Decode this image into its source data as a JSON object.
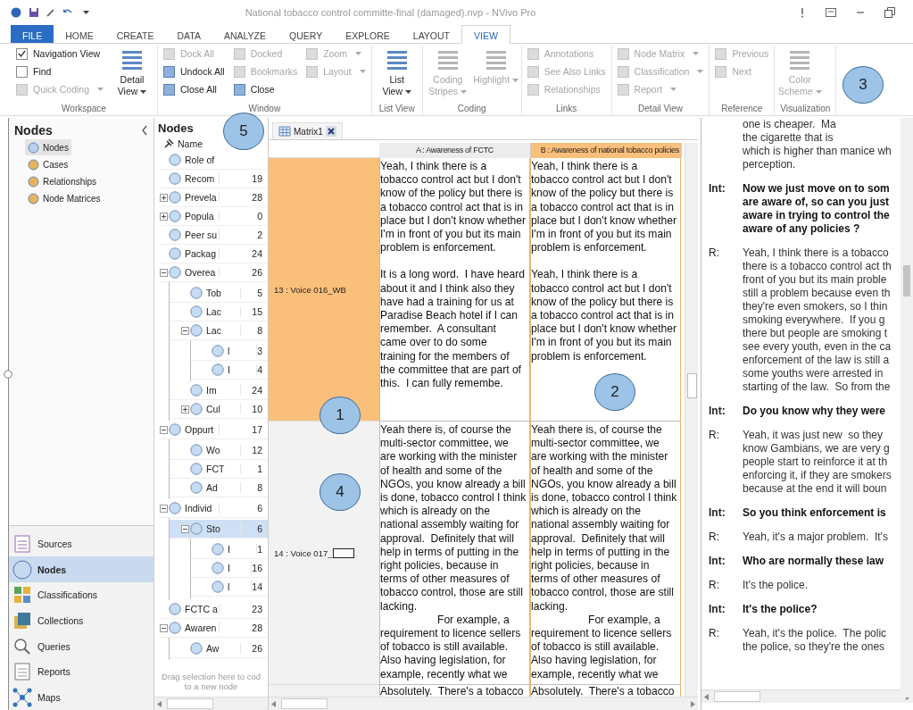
{
  "window": {
    "title": "National tobacco control committe-final (damaged).nvp - NVivo Pro"
  },
  "ribbon": {
    "tabs": [
      {
        "label": "FILE",
        "selected": false,
        "kind": "file"
      },
      {
        "label": "HOME",
        "selected": false
      },
      {
        "label": "CREATE",
        "selected": false
      },
      {
        "label": "DATA",
        "selected": false
      },
      {
        "label": "ANALYZE",
        "selected": false
      },
      {
        "label": "QUERY",
        "selected": false
      },
      {
        "label": "EXPLORE",
        "selected": false
      },
      {
        "label": "LAYOUT",
        "selected": false
      },
      {
        "label": "VIEW",
        "selected": true
      }
    ],
    "groups": [
      {
        "label": "Workspace",
        "columns": [
          [
            {
              "kind": "checkbox",
              "label": "Navigation View",
              "checked": true,
              "disabled": false
            },
            {
              "kind": "checkbox",
              "label": "Find",
              "checked": false,
              "disabled": false
            },
            {
              "kind": "small",
              "label": "Quick Coding",
              "disabled": true,
              "dropdown": true
            }
          ],
          [
            {
              "kind": "large",
              "label": "Detail\nView",
              "disabled": false,
              "dropdown": true
            }
          ]
        ]
      },
      {
        "label": "Window",
        "columns": [
          [
            {
              "kind": "small",
              "label": "Dock All",
              "disabled": true
            },
            {
              "kind": "small",
              "label": "Undock All",
              "disabled": false
            },
            {
              "kind": "small",
              "label": "Close All",
              "disabled": false
            }
          ],
          [
            {
              "kind": "small",
              "label": "Docked",
              "disabled": true
            },
            {
              "kind": "small",
              "label": "Bookmarks",
              "disabled": true
            },
            {
              "kind": "small",
              "label": "Close",
              "disabled": false
            }
          ],
          [
            {
              "kind": "small",
              "label": "Zoom",
              "disabled": true,
              "dropdown": true
            },
            {
              "kind": "small",
              "label": "Layout",
              "disabled": true,
              "dropdown": true
            }
          ]
        ]
      },
      {
        "label": "List View",
        "columns": [
          [
            {
              "kind": "large",
              "label": "List\nView",
              "disabled": false,
              "dropdown": true
            }
          ]
        ]
      },
      {
        "label": "Coding",
        "columns": [
          [
            {
              "kind": "large",
              "label": "Coding\nStripes",
              "disabled": true,
              "dropdown": true
            }
          ],
          [
            {
              "kind": "large",
              "label": "Highlight",
              "disabled": true,
              "dropdown": true
            }
          ]
        ]
      },
      {
        "label": "Links",
        "columns": [
          [
            {
              "kind": "small",
              "label": "Annotations",
              "disabled": true
            },
            {
              "kind": "small",
              "label": "See Also Links",
              "disabled": true
            },
            {
              "kind": "small",
              "label": "Relationships",
              "disabled": true
            }
          ]
        ]
      },
      {
        "label": "Detail View",
        "columns": [
          [
            {
              "kind": "small",
              "label": "Node Matrix",
              "disabled": true,
              "dropdown": true
            },
            {
              "kind": "small",
              "label": "Classification",
              "disabled": true,
              "dropdown": true
            },
            {
              "kind": "small",
              "label": "Report",
              "disabled": true,
              "dropdown": true
            }
          ]
        ]
      },
      {
        "label": "Reference",
        "columns": [
          [
            {
              "kind": "small",
              "label": "Previous",
              "disabled": true
            },
            {
              "kind": "small",
              "label": "Next",
              "disabled": true
            }
          ]
        ]
      },
      {
        "label": "Visualization",
        "columns": [
          [
            {
              "kind": "large",
              "label": "Color\nScheme",
              "disabled": true,
              "dropdown": true
            }
          ]
        ]
      }
    ]
  },
  "navigation": {
    "title": "Nodes",
    "items": [
      {
        "label": "Nodes",
        "selected": true
      },
      {
        "label": "Cases",
        "selected": false
      },
      {
        "label": "Relationships",
        "selected": false
      },
      {
        "label": "Node Matrices",
        "selected": false
      }
    ],
    "sections": [
      {
        "label": "Sources",
        "selected": false
      },
      {
        "label": "Nodes",
        "selected": true
      },
      {
        "label": "Classifications",
        "selected": false
      },
      {
        "label": "Collections",
        "selected": false
      },
      {
        "label": "Queries",
        "selected": false
      },
      {
        "label": "Reports",
        "selected": false
      },
      {
        "label": "Maps",
        "selected": false
      }
    ]
  },
  "nodes_list": {
    "title": "Nodes",
    "name_column": "Name",
    "hint": "Drag selection here to cod\nto a new node",
    "items": [
      {
        "name": "Role of",
        "selected": false
      },
      {
        "name": "Recom",
        "count": "19",
        "selected": false
      },
      {
        "name": "Prevela",
        "count": "28",
        "selected": false,
        "expanded": false
      },
      {
        "name": "Popula",
        "count": "0",
        "selected": false,
        "expanded": false
      },
      {
        "name": "Peer su",
        "count": "2",
        "selected": false
      },
      {
        "name": "Packag",
        "count": "24",
        "selected": false
      },
      {
        "name": "Overea",
        "count": "26",
        "selected": false,
        "expanded": true,
        "children": [
          {
            "name": "Tob",
            "count": "5",
            "selected": false
          },
          {
            "name": "Lac",
            "count": "15",
            "selected": false
          },
          {
            "name": "Lac",
            "count": "8",
            "selected": false,
            "expanded": true,
            "children": [
              {
                "name": "l",
                "count": "3",
                "selected": false
              },
              {
                "name": "I",
                "count": "4",
                "selected": false
              }
            ]
          },
          {
            "name": "Im",
            "count": "24",
            "selected": false
          },
          {
            "name": "Cul",
            "count": "10",
            "selected": false,
            "expanded": false
          }
        ]
      },
      {
        "name": "Oppurt",
        "count": "17",
        "selected": false,
        "expanded": true,
        "children": [
          {
            "name": "Wo",
            "count": "12",
            "selected": false
          },
          {
            "name": "FCT",
            "count": "1",
            "selected": false
          },
          {
            "name": "Ad",
            "count": "8",
            "selected": false
          }
        ]
      },
      {
        "name": "Individ",
        "count": "6",
        "selected": false,
        "expanded": true,
        "children": [
          {
            "name": "Sto",
            "count": "6",
            "selected": true,
            "expanded": true,
            "children": [
              {
                "name": "I",
                "count": "1",
                "selected": false
              },
              {
                "name": "I",
                "count": "16",
                "selected": false
              },
              {
                "name": "l",
                "count": "14",
                "selected": false
              }
            ]
          }
        ]
      },
      {
        "name": "FCTC a",
        "count": "23",
        "selected": false
      },
      {
        "name": "Awaren",
        "count": "28",
        "selected": false,
        "expanded": true,
        "children": [
          {
            "name": "Aw",
            "count": "26",
            "selected": false
          }
        ]
      }
    ]
  },
  "matrix": {
    "tab": "Matrix1",
    "columns": [
      {
        "label": "A : Awareness of FCTC",
        "selected": false
      },
      {
        "label": "B : Awareness of national tobacco policies",
        "selected": true
      }
    ],
    "rows": [
      {
        "label": "13 : Voice 016_WB",
        "selected": true,
        "cells": [
          [
            {
              "text": "Yeah, I think there is a\ntobacco control act but I don't\nknow of the policy but there is\na tobacco control act that is in\nplace but I don't know whether\nI'm in front of you but its main\nproblem is enforcement."
            },
            {
              "text": "It is a long word.  I have heard\nabout it and I think also they\nhave had a training for us at\nParadise Beach hotel if I can\nremember.  A consultant\ncame over to do some\ntraining for the members of\nthe committee that are part of\nthis.  I can fully remembe."
            }
          ],
          [
            {
              "text": "Yeah, I think there is a\ntobacco control act but I don't\nknow of the policy but there is\na tobacco control act that is in\nplace but I don't know whether\nI'm in front of you but its main\nproblem is enforcement."
            },
            {
              "text": "Yeah, I think there is a\ntobacco control act but I don't\nknow of the policy but there is\na tobacco control act that is in\nplace but I don't know whether\nI'm in front of you but its main\nproblem is enforcement."
            }
          ]
        ]
      },
      {
        "label": "14 : Voice 017_",
        "editing": true,
        "selected": false,
        "cells": [
          [
            {
              "text": "Yeah there is, of course the\nmulti-sector committee, we\nare working with the minister\nof health and some of the\nNGOs, you know already a bill\nis done, tobacco control I think\nwhich is already on the\nnational assembly waiting for\napproval.  Definitely that will\nhelp in terms of putting in the\nright policies, because in\nterms of other measures of\ntobacco control, those are still\nlacking."
            },
            {
              "text": "For example, a\nrequirement to licence sellers\nof tobacco is still available.\nAlso having legislation, for\nexample, recently what we",
              "indent": true
            }
          ],
          [
            {
              "text": "Yeah there is, of course the\nmulti-sector committee, we\nare working with the minister\nof health and some of the\nNGOs, you know already a bill\nis done, tobacco control I think\nwhich is already on the\nnational assembly waiting for\napproval.  Definitely that will\nhelp in terms of putting in the\nright policies, because in\nterms of other measures of\ntobacco control, those are still\nlacking."
            },
            {
              "text": "For example, a\nrequirement to licence sellers\nof tobacco is still available.\nAlso having legislation, for\nexample, recently what we",
              "indent": true
            }
          ]
        ]
      },
      {
        "selected": false,
        "cells": [
          [
            {
              "text": "Absolutely.  There's a tobacco"
            }
          ],
          [
            {
              "text": "Absolutely.  There's a tobacco"
            }
          ]
        ]
      }
    ]
  },
  "transcript": [
    {
      "kind": "respondent",
      "lines": [
        "one is cheaper.  Ma",
        "the cigarette that is",
        "which is higher than manice wh",
        "perception."
      ]
    },
    {
      "kind": "interviewer",
      "speaker": "Int:",
      "lines": [
        "Now we just move on to som",
        "are aware of, so can you just",
        "aware in trying to control the",
        "aware of any policies ?"
      ]
    },
    {
      "kind": "respondent",
      "speaker": "R:",
      "lines": [
        "Yeah, I think there is a tobacco",
        "there is a tobacco control act th",
        "front of you but its main proble",
        "still a problem because even th",
        "they're even smokers, so I thin",
        "smoking everywhere.  If you g",
        "there but people are smoking t",
        "see every youth, even in the ca",
        "enforcement of the law is still a",
        "some youths were arrested in",
        "starting of the law.  So from the"
      ]
    },
    {
      "kind": "interviewer",
      "speaker": "Int:",
      "lines": [
        "Do you know why they were"
      ]
    },
    {
      "kind": "respondent",
      "speaker": "R:",
      "lines": [
        "Yeah, it was just new  so they",
        "know Gambians, we are very g",
        "people start to reinforce it at th",
        "enforcing it, if they are smokers",
        "because at the end it will boun"
      ]
    },
    {
      "kind": "interviewer",
      "speaker": "Int:",
      "lines": [
        "So you think enforcement is"
      ]
    },
    {
      "kind": "respondent",
      "speaker": "R:",
      "lines": [
        "Yeah, it's a major problem.  It's"
      ]
    },
    {
      "kind": "interviewer",
      "speaker": "Int:",
      "lines": [
        "Who are normally these law"
      ]
    },
    {
      "kind": "respondent",
      "speaker": "R:",
      "lines": [
        "It's the police."
      ]
    },
    {
      "kind": "interviewer",
      "speaker": "Int:",
      "lines": [
        "It's the police?"
      ]
    },
    {
      "kind": "respondent",
      "speaker": "R:",
      "lines": [
        "Yeah, it's the police.  The polic",
        "the police, so they're the ones"
      ]
    }
  ],
  "callouts": [
    {
      "label": "1"
    },
    {
      "label": "2"
    },
    {
      "label": "3"
    },
    {
      "label": "4"
    },
    {
      "label": "5"
    }
  ]
}
